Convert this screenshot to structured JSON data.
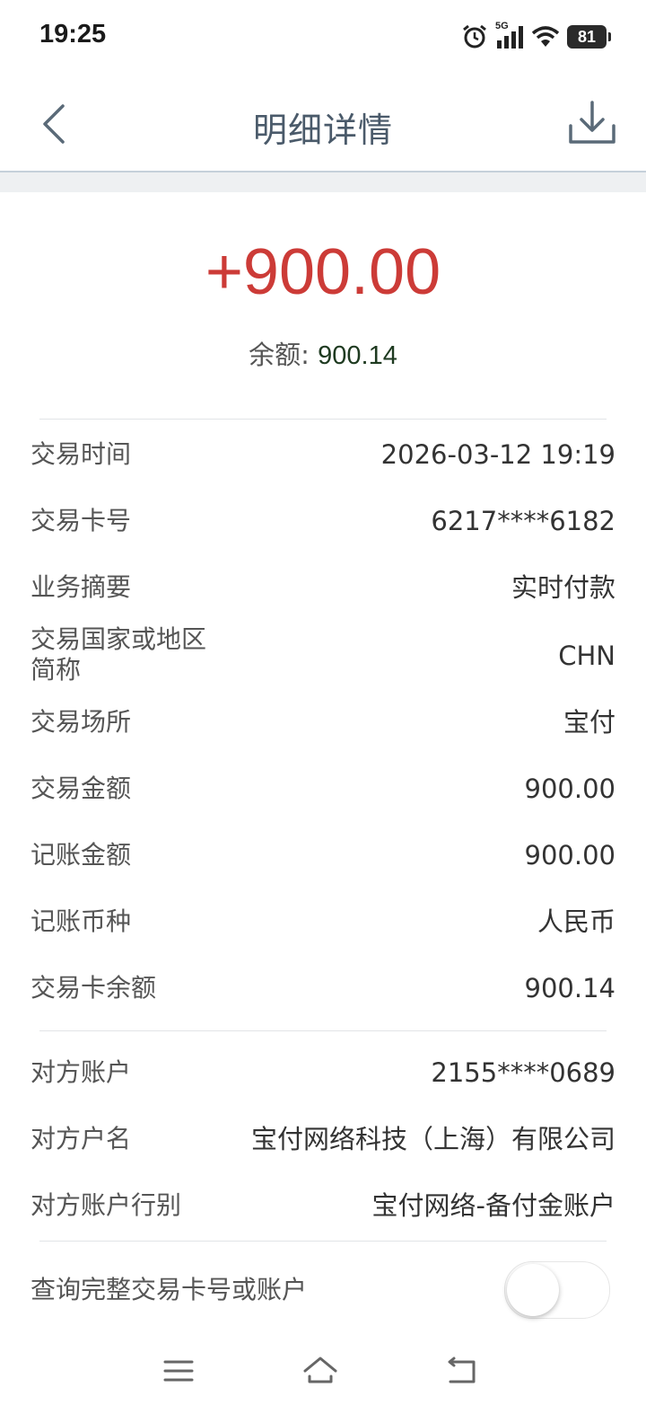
{
  "status": {
    "time": "19:25",
    "network": "5G",
    "battery": "81",
    "icons": [
      "alarm-icon",
      "signal-icon",
      "wifi-icon",
      "battery-icon"
    ]
  },
  "header": {
    "title": "明细详情",
    "back_icon": "chevron-left-icon",
    "download_icon": "download-icon"
  },
  "summary": {
    "amount": "+900.00",
    "balance_label": "余额: ",
    "balance_value": "900.14",
    "amount_color": "#cc3b37"
  },
  "details": [
    {
      "label": "交易时间",
      "value": "2026-03-12 19:19"
    },
    {
      "label": "交易卡号",
      "value": "6217****6182"
    },
    {
      "label": "业务摘要",
      "value": "实时付款"
    },
    {
      "label": "交易国家或地区",
      "label2": "简称",
      "value": "CHN"
    },
    {
      "label": "交易场所",
      "value": "宝付"
    },
    {
      "label": "交易金额",
      "value": "900.00"
    },
    {
      "label": "记账金额",
      "value": "900.00"
    },
    {
      "label": "记账币种",
      "value": "人民币"
    },
    {
      "label": "交易卡余额",
      "value": "900.14"
    }
  ],
  "counterparty": [
    {
      "label": "对方账户",
      "value": "2155****0689"
    },
    {
      "label": "对方户名",
      "value": "宝付网络科技（上海）有限公司"
    },
    {
      "label": "对方账户行别",
      "value": "宝付网络-备付金账户"
    }
  ],
  "toggle": {
    "label": "查询完整交易卡号或账户",
    "state": "off"
  },
  "system_nav": [
    "menu-icon",
    "home-icon",
    "back-icon"
  ]
}
